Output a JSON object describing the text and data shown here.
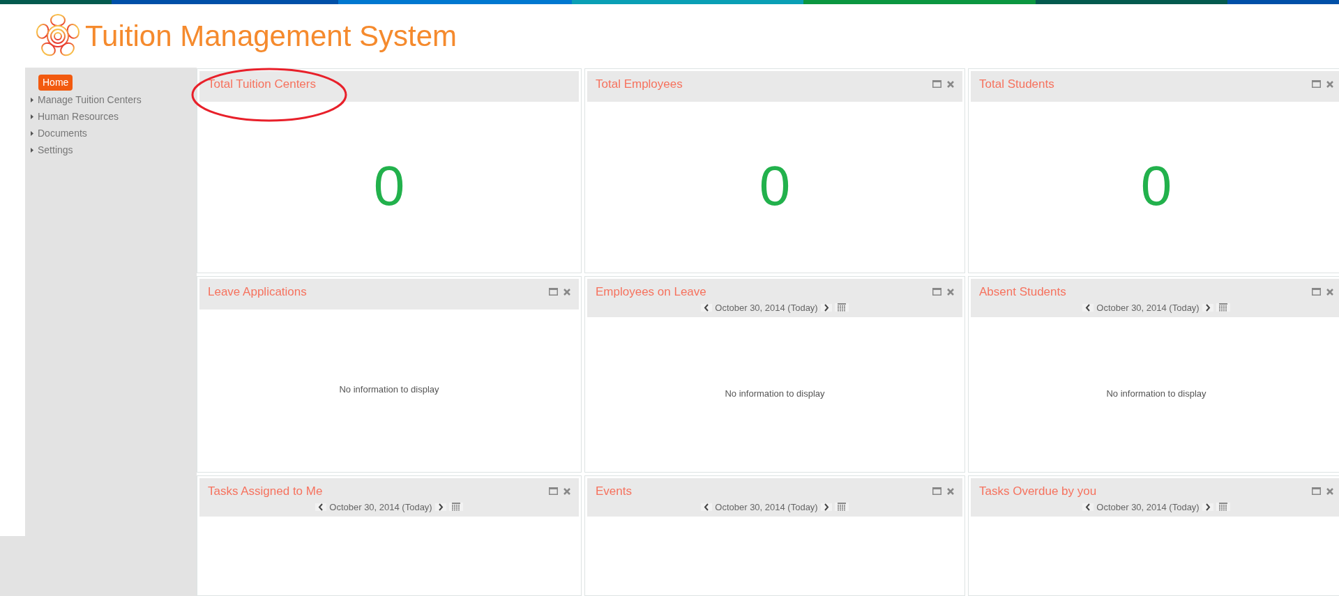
{
  "header": {
    "title": "Tuition Management System"
  },
  "sidebar": {
    "items": [
      {
        "label": "Home",
        "selected": true,
        "has_arrow": false
      },
      {
        "label": "Manage Tuition Centers",
        "selected": false,
        "has_arrow": true
      },
      {
        "label": "Human Resources",
        "selected": false,
        "has_arrow": true
      },
      {
        "label": "Documents",
        "selected": false,
        "has_arrow": true
      },
      {
        "label": "Settings",
        "selected": false,
        "has_arrow": true
      }
    ]
  },
  "widgets": [
    {
      "title": "Total Tuition Centers",
      "kind": "count",
      "value": "0",
      "circled": true,
      "controls": false
    },
    {
      "title": "Total Employees",
      "kind": "count",
      "value": "0",
      "circled": false,
      "controls": true
    },
    {
      "title": "Total Students",
      "kind": "count",
      "value": "0",
      "circled": false,
      "controls": true
    },
    {
      "title": "Leave Applications",
      "kind": "message",
      "message": "No information to display",
      "circled": false,
      "controls": true
    },
    {
      "title": "Employees on Leave",
      "kind": "message",
      "date": "October 30, 2014 (Today)",
      "message": "No information to display",
      "circled": false,
      "controls": true
    },
    {
      "title": "Absent Students",
      "kind": "message",
      "date": "October 30, 2014 (Today)",
      "message": "No information to display",
      "circled": false,
      "controls": true
    },
    {
      "title": "Tasks Assigned to Me",
      "kind": "empty",
      "date": "October 30, 2014 (Today)",
      "circled": false,
      "controls": true
    },
    {
      "title": "Events",
      "kind": "empty",
      "date": "October 30, 2014 (Today)",
      "circled": false,
      "controls": true
    },
    {
      "title": "Tasks Overdue by you",
      "kind": "empty",
      "date": "October 30, 2014 (Today)",
      "circled": false,
      "controls": true
    }
  ]
}
